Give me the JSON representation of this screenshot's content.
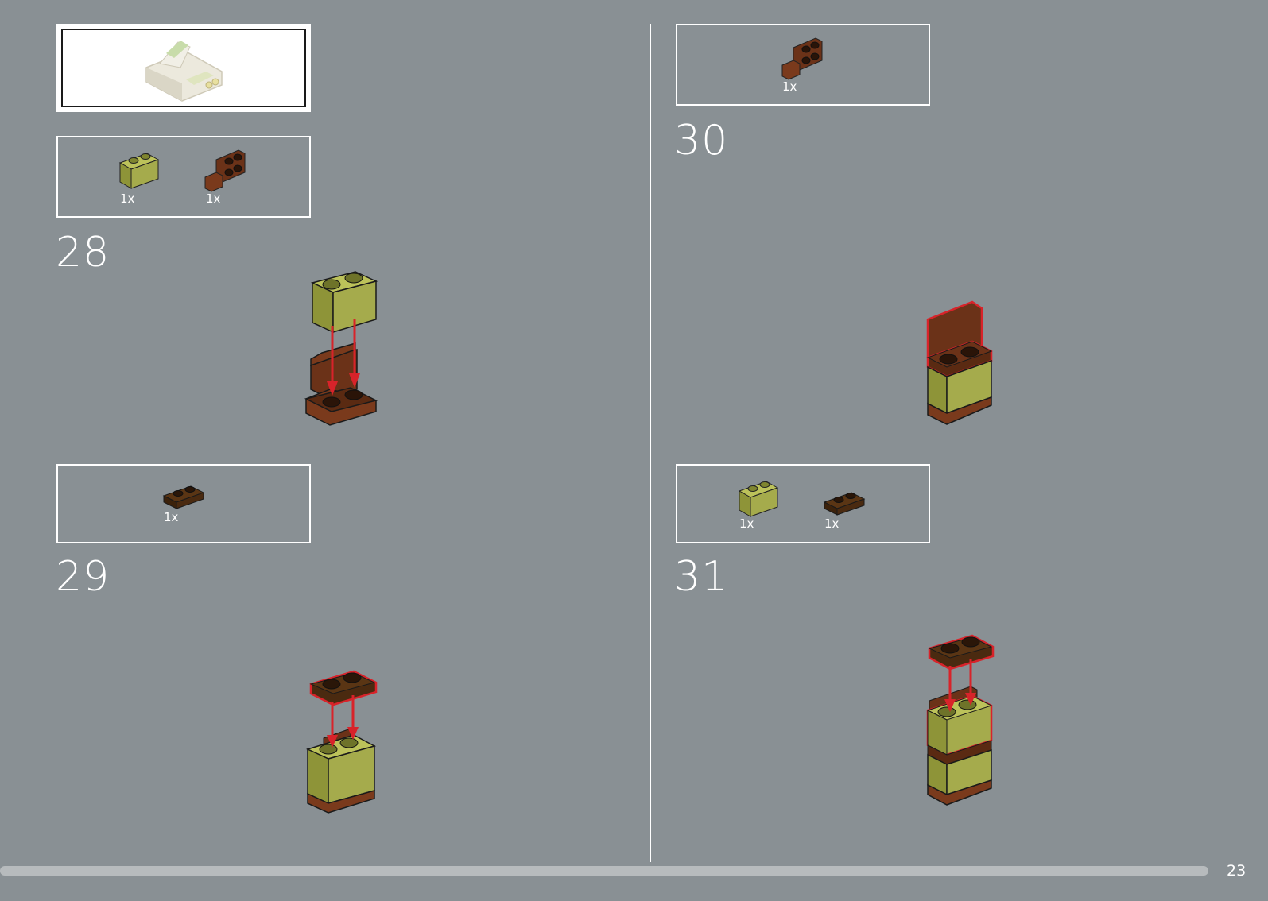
{
  "page": {
    "number": "23",
    "progress_percent": 100
  },
  "steps": [
    {
      "number": "28",
      "parts": [
        {
          "qty": "1x",
          "part": "olive-brick-1x2-icon"
        },
        {
          "qty": "1x",
          "part": "brown-bracket-icon"
        }
      ]
    },
    {
      "number": "29",
      "parts": [
        {
          "qty": "1x",
          "part": "dark-brown-plate-1x2-icon"
        }
      ]
    },
    {
      "number": "30",
      "parts": [
        {
          "qty": "1x",
          "part": "brown-bracket-icon"
        }
      ]
    },
    {
      "number": "31",
      "parts": [
        {
          "qty": "1x",
          "part": "olive-brick-1x2-icon"
        },
        {
          "qty": "1x",
          "part": "dark-brown-plate-1x2-icon"
        }
      ]
    }
  ],
  "colors": {
    "background": "#899094",
    "olive": "#a5ab4c",
    "brown": "#6b3218",
    "dark_brown": "#4a2a10",
    "arrow": "#d8232a"
  }
}
